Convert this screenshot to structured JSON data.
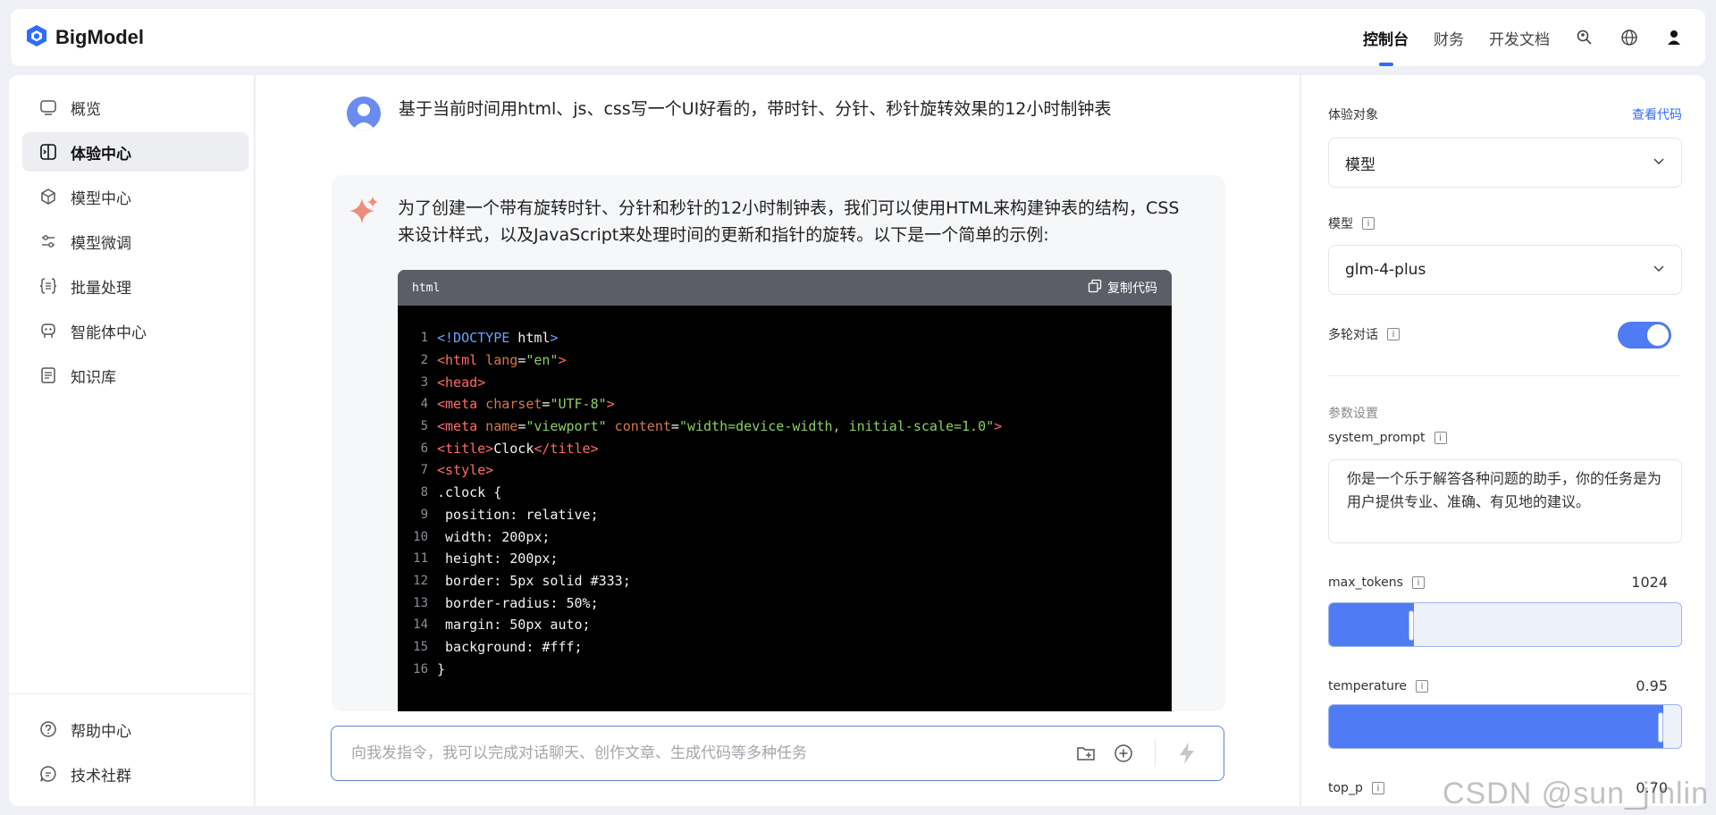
{
  "header": {
    "logo_text": "BigModel",
    "nav": [
      "控制台",
      "财务",
      "开发文档"
    ],
    "active_nav": "控制台",
    "icons": [
      "search-user-icon",
      "globe-icon",
      "user-icon"
    ],
    "accent": "#2f6bff"
  },
  "sidebar": {
    "items": [
      {
        "label": "概览",
        "icon": "overview-icon"
      },
      {
        "label": "体验中心",
        "icon": "experience-icon",
        "active": true
      },
      {
        "label": "模型中心",
        "icon": "cube-icon"
      },
      {
        "label": "模型微调",
        "icon": "sliders-icon"
      },
      {
        "label": "批量处理",
        "icon": "batch-icon"
      },
      {
        "label": "智能体中心",
        "icon": "robot-icon"
      },
      {
        "label": "知识库",
        "icon": "book-icon"
      }
    ],
    "bottom": [
      {
        "label": "帮助中心",
        "icon": "help-icon"
      },
      {
        "label": "技术社群",
        "icon": "chat-icon"
      }
    ]
  },
  "chat": {
    "user_message": "基于当前时间用html、js、css写一个UI好看的，带时针、分针、秒针旋转效果的12小时制钟表",
    "ai_message": "为了创建一个带有旋转时针、分针和秒针的12小时制钟表，我们可以使用HTML来构建钟表的结构，CSS来设计样式，以及JavaScript来处理时间的更新和指针的旋转。以下是一个简单的示例:",
    "code": {
      "language": "html",
      "copy_label": "复制代码",
      "lines": [
        {
          "n": "1",
          "parts": [
            [
              "kw",
              "<!DOCTYPE"
            ],
            [
              "txt",
              " html"
            ],
            [
              "kw",
              ">"
            ]
          ]
        },
        {
          "n": "2",
          "parts": [
            [
              "tag",
              "<html"
            ],
            [
              "attr",
              " lang"
            ],
            [
              "txt",
              "="
            ],
            [
              "str",
              "\"en\""
            ],
            [
              "tag",
              ">"
            ]
          ]
        },
        {
          "n": "3",
          "parts": [
            [
              "tag",
              "<head>"
            ]
          ]
        },
        {
          "n": "4",
          "parts": [
            [
              "tag",
              "<meta"
            ],
            [
              "attr",
              " charset"
            ],
            [
              "txt",
              "="
            ],
            [
              "str",
              "\"UTF-8\""
            ],
            [
              "tag",
              ">"
            ]
          ]
        },
        {
          "n": "5",
          "parts": [
            [
              "tag",
              "<meta"
            ],
            [
              "attr",
              " name"
            ],
            [
              "txt",
              "="
            ],
            [
              "str",
              "\"viewport\""
            ],
            [
              "attr",
              " content"
            ],
            [
              "txt",
              "="
            ],
            [
              "str",
              "\"width=device-width, initial-scale=1.0\""
            ],
            [
              "tag",
              ">"
            ]
          ]
        },
        {
          "n": "6",
          "parts": [
            [
              "tag",
              "<title>"
            ],
            [
              "txt",
              "Clock"
            ],
            [
              "tag",
              "</title>"
            ]
          ]
        },
        {
          "n": "7",
          "parts": [
            [
              "tag",
              "<style>"
            ]
          ]
        },
        {
          "n": "8",
          "parts": [
            [
              "txt",
              ".clock {"
            ]
          ]
        },
        {
          "n": "9",
          "parts": [
            [
              "txt",
              " position: relative;"
            ]
          ]
        },
        {
          "n": "10",
          "parts": [
            [
              "txt",
              " width: 200px;"
            ]
          ]
        },
        {
          "n": "11",
          "parts": [
            [
              "txt",
              " height: 200px;"
            ]
          ]
        },
        {
          "n": "12",
          "parts": [
            [
              "txt",
              " border: 5px solid #333;"
            ]
          ]
        },
        {
          "n": "13",
          "parts": [
            [
              "txt",
              " border-radius: 50%;"
            ]
          ]
        },
        {
          "n": "14",
          "parts": [
            [
              "txt",
              " margin: 50px auto;"
            ]
          ]
        },
        {
          "n": "15",
          "parts": [
            [
              "txt",
              " background: #fff;"
            ]
          ]
        },
        {
          "n": "16",
          "parts": [
            [
              "txt",
              "}"
            ]
          ]
        }
      ]
    },
    "input_placeholder": "向我发指令，我可以完成对话聊天、创作文章、生成代码等多种任务"
  },
  "panel": {
    "target_label": "体验对象",
    "view_code": "查看代码",
    "target_value": "模型",
    "model_label": "模型",
    "model_value": "glm-4-plus",
    "multi_turn_label": "多轮对话",
    "multi_turn_on": true,
    "params_title": "参数设置",
    "system_prompt_label": "system_prompt",
    "system_prompt_value": "你是一个乐于解答各种问题的助手，你的任务是为用户提供专业、准确、有见地的建议。",
    "max_tokens_label": "max_tokens",
    "max_tokens_value": "1024",
    "max_tokens_fraction": 0.24,
    "temperature_label": "temperature",
    "temperature_value": "0.95",
    "temperature_fraction": 0.95,
    "top_p_label": "top_p",
    "top_p_value": "0.70"
  },
  "watermark": "CSDN @sun_jinlin"
}
